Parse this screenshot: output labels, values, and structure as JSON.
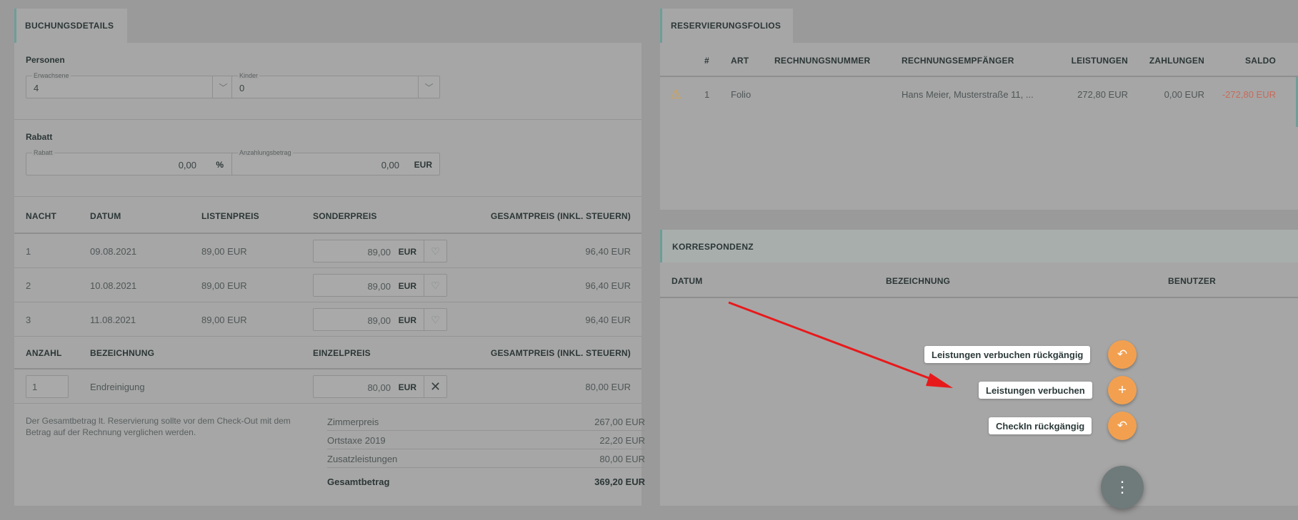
{
  "left": {
    "tab_title": "BUCHUNGSDETAILS",
    "persons": {
      "title": "Personen",
      "adults": {
        "label": "Erwachsene",
        "value": "4"
      },
      "children": {
        "label": "Kinder",
        "value": "0"
      }
    },
    "discount": {
      "title": "Rabatt",
      "rate": {
        "label": "Rabatt",
        "value": "0,00",
        "unit": "%"
      },
      "deposit": {
        "label": "Anzahlungsbetrag",
        "value": "0,00",
        "unit": "EUR"
      }
    },
    "nights_table": {
      "headers": [
        "NACHT",
        "DATUM",
        "LISTENPREIS",
        "SONDERPREIS",
        "GESAMTPREIS (INKL. STEUERN)"
      ],
      "rows": [
        {
          "night": "1",
          "date": "09.08.2021",
          "list": "89,00 EUR",
          "special": "89,00",
          "unit": "EUR",
          "total": "96,40 EUR"
        },
        {
          "night": "2",
          "date": "10.08.2021",
          "list": "89,00 EUR",
          "special": "89,00",
          "unit": "EUR",
          "total": "96,40 EUR"
        },
        {
          "night": "3",
          "date": "11.08.2021",
          "list": "89,00 EUR",
          "special": "89,00",
          "unit": "EUR",
          "total": "96,40 EUR"
        }
      ]
    },
    "extras_table": {
      "headers": [
        "ANZAHL",
        "BEZEICHNUNG",
        "EINZELPREIS",
        "GESAMTPREIS (INKL. STEUERN)"
      ],
      "rows": [
        {
          "qty": "1",
          "name": "Endreinigung",
          "price": "80,00",
          "unit": "EUR",
          "total": "80,00 EUR"
        }
      ]
    },
    "note": "Der Gesamtbetrag lt. Reservierung sollte vor dem Check-Out mit dem Betrag auf der Rechnung verglichen werden.",
    "summary": [
      {
        "label": "Zimmerpreis",
        "value": "267,00 EUR"
      },
      {
        "label": "Ortstaxe 2019",
        "value": "22,20 EUR"
      },
      {
        "label": "Zusatzleistungen",
        "value": "80,00 EUR"
      }
    ],
    "total": {
      "label": "Gesamtbetrag",
      "value": "369,20 EUR"
    }
  },
  "folios": {
    "tab_title": "RESERVIERUNGSFOLIOS",
    "headers": [
      "#",
      "ART",
      "RECHNUNGSNUMMER",
      "RECHNUNGSEMPFÄNGER",
      "LEISTUNGEN",
      "ZAHLUNGEN",
      "SALDO"
    ],
    "rows": [
      {
        "num": "1",
        "type": "Folio",
        "invoice": "",
        "recipient": "Hans Meier, Musterstraße 11, ...",
        "services": "272,80 EUR",
        "payments": "0,00 EUR",
        "balance": "-272,80 EUR"
      }
    ]
  },
  "correspondence": {
    "tab_title": "KORRESPONDENZ",
    "headers": [
      "DATUM",
      "BEZEICHNUNG",
      "BENUTZER"
    ]
  },
  "fab": {
    "actions": [
      {
        "label": "Leistungen verbuchen rückgängig",
        "icon": "undo-icon"
      },
      {
        "label": "Leistungen verbuchen",
        "icon": "plus-icon"
      },
      {
        "label": "CheckIn rückgängig",
        "icon": "undo-icon"
      }
    ],
    "main_icon": "more-vertical-icon"
  },
  "colors": {
    "accent": "#f2a050",
    "arrow": "#e8191b",
    "negative": "#c86a5a",
    "warning": "#d9a24a"
  }
}
